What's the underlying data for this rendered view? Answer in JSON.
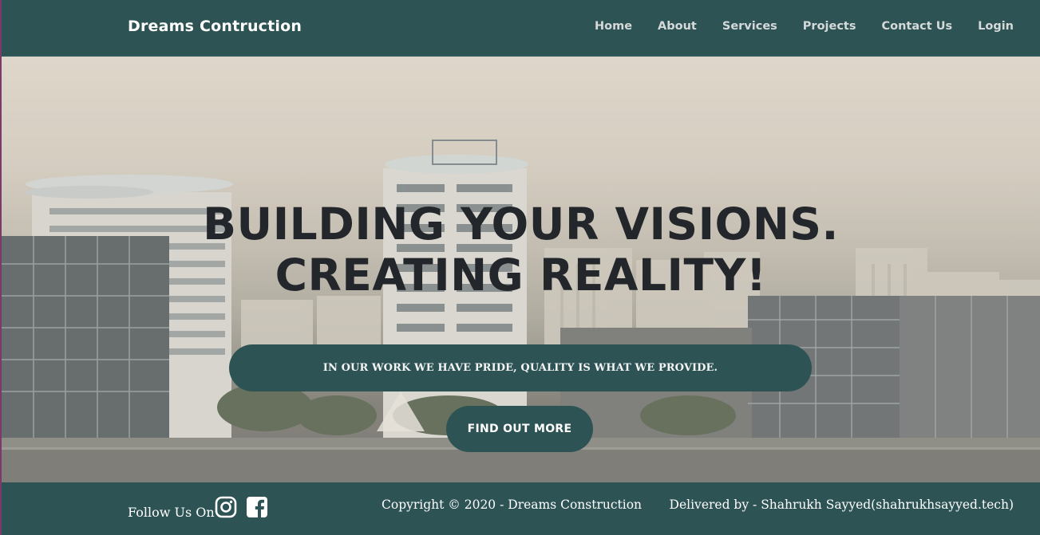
{
  "colors": {
    "primary": "#2d5354",
    "headline": "#23272b",
    "nav_text": "#d6d9d9",
    "white": "#ffffff"
  },
  "navbar": {
    "brand": "Dreams Contruction",
    "links": [
      "Home",
      "About",
      "Services",
      "Projects",
      "Contact Us",
      "Login"
    ]
  },
  "hero": {
    "headline_line1": "BUILDING YOUR VISIONS.",
    "headline_line2": "CREATING REALITY!",
    "tagline": "IN OUR WORK WE HAVE PRIDE, QUALITY IS WHAT WE PROVIDE.",
    "cta_label": "FIND OUT MORE",
    "background": "city-buildings-photo"
  },
  "footer": {
    "follow_label": "Follow Us On",
    "social_icons": [
      "instagram-icon",
      "facebook-icon"
    ],
    "copyright": "Copyright © 2020 - Dreams Construction",
    "delivered_by": "Delivered by - Shahrukh Sayyed(shahrukhsayyed.tech)"
  }
}
